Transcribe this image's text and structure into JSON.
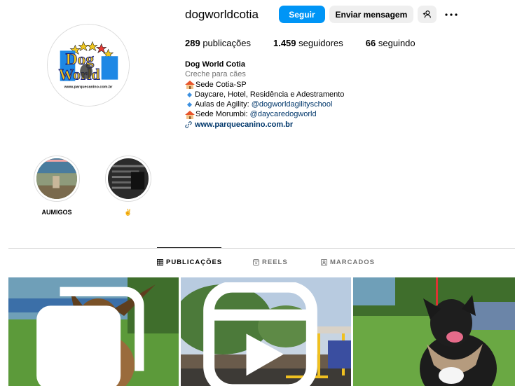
{
  "profile": {
    "username": "dogworldcotia",
    "avatar_alt": "Dog World logo",
    "logo_url_text": "www.parquecanino.com.br"
  },
  "actions": {
    "follow_label": "Seguir",
    "message_label": "Enviar mensagem",
    "add_user_icon": "add-user-icon",
    "more_icon": "more-options-icon"
  },
  "stats": {
    "posts_count": "289",
    "posts_label": "publicações",
    "followers_count": "1.459",
    "followers_label": "seguidores",
    "following_count": "66",
    "following_label": "seguindo"
  },
  "bio": {
    "name": "Dog World Cotia",
    "category": "Creche para cães",
    "line1": "Sede Cotia-SP",
    "line2": "Daycare, Hotel, Residência e Adestramento",
    "line3_prefix": "Aulas de Agility: ",
    "line3_mention": "@dogworldagilityschool",
    "line4_prefix": "Sede Morumbi: ",
    "line4_mention": "@daycaredogworld",
    "website": "www.parquecanino.com.br"
  },
  "highlights": [
    {
      "label": "AUMIGOS"
    },
    {
      "label": "✌"
    }
  ],
  "tabs": [
    {
      "label": "PUBLICAÇÕES",
      "icon": "grid-icon",
      "active": true
    },
    {
      "label": "REELS",
      "icon": "reels-icon",
      "active": false
    },
    {
      "label": "MARCADOS",
      "icon": "tagged-icon",
      "active": false
    }
  ],
  "colors": {
    "primary_button": "#0095f6",
    "secondary_button": "#efefef",
    "mention": "#00376b",
    "muted": "#737373"
  }
}
